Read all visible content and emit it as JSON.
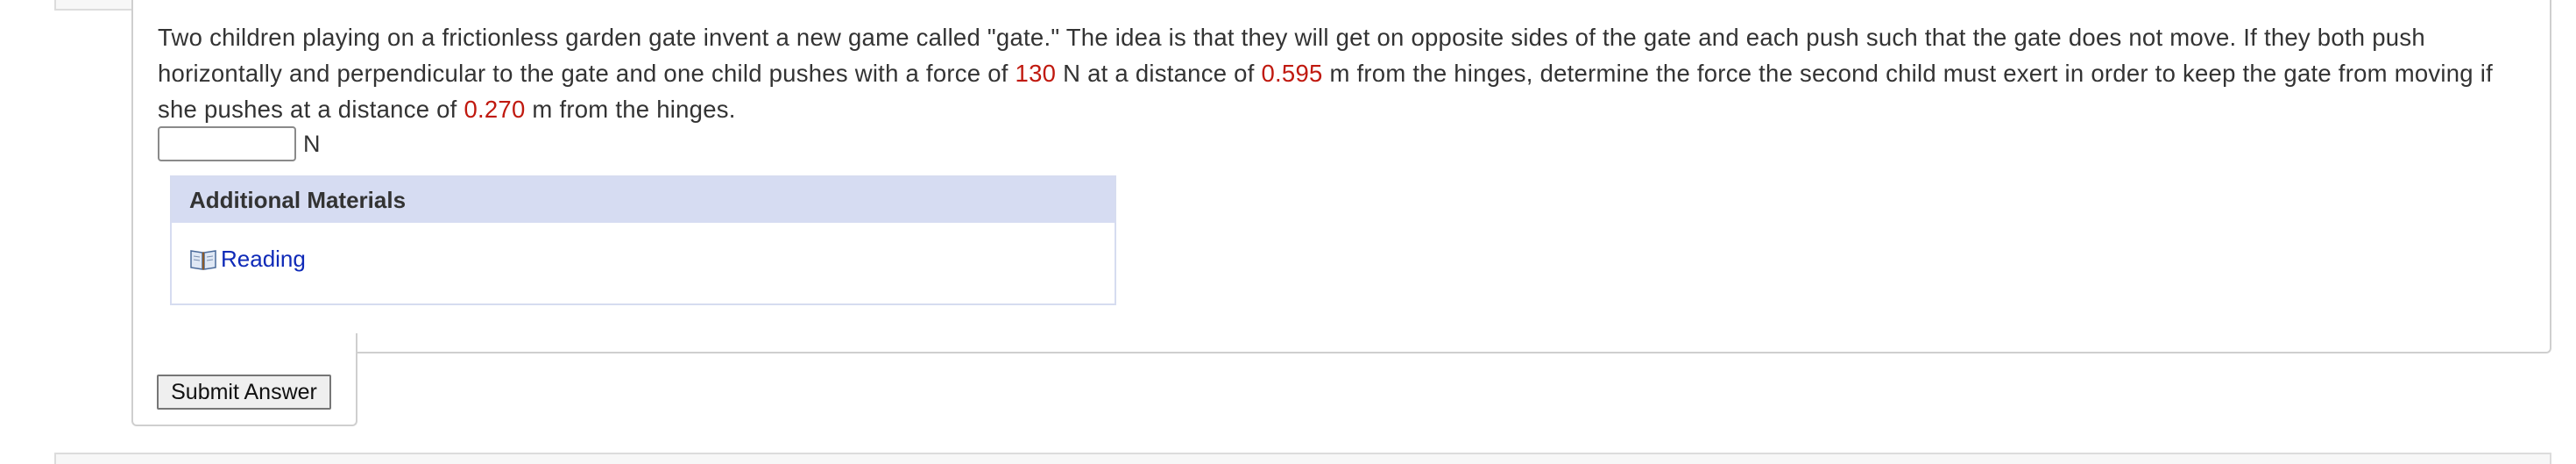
{
  "question": {
    "part1": "Two children playing on a frictionless garden gate invent a new game called \"gate.\" The idea is that they will get on opposite sides of the gate and each push such that the gate does not move. If they both push horizontally and perpendicular to the gate and one child pushes with a force of ",
    "force": "130",
    "part2": " N at a distance of ",
    "distance1": "0.595",
    "part3": " m from the hinges, determine the force the second child must exert in order to keep the gate from moving if she pushes at a distance of ",
    "distance2": "0.270",
    "part4": " m from the hinges."
  },
  "answer": {
    "value": "",
    "unit": "N"
  },
  "materials": {
    "header": "Additional Materials",
    "items": [
      {
        "label": "Reading",
        "icon": "book-icon"
      }
    ]
  },
  "submit_label": "Submit Answer",
  "colors": {
    "number_highlight": "#c0190f",
    "link": "#0f2ab8",
    "materials_header_bg": "#d6dcf2"
  }
}
